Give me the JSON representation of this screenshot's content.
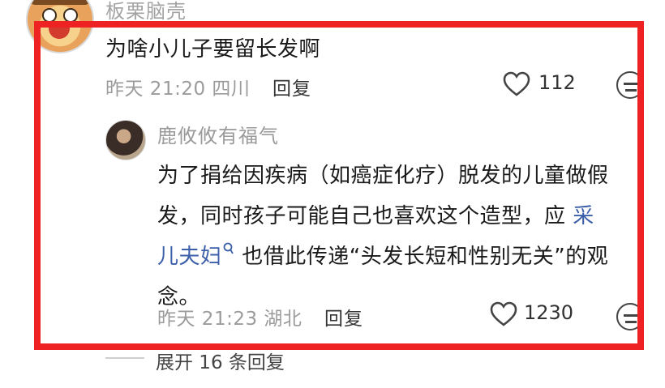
{
  "top_comment": {
    "username": "板栗脑壳",
    "text": "为啥小儿子要留长发啊",
    "meta": "昨天 21:20 四川",
    "reply_label": "回复",
    "likes": "112"
  },
  "reply_comment": {
    "username": "鹿攸攸有福气",
    "lines": [
      "为了捐给因疾病（如癌症化疗）脱发的儿童做假",
      "发，同时孩子可能自己也喜欢这个造型，应"
    ],
    "mention_a": "采",
    "mention_b": "儿夫妇",
    "line3_rest": "也借此传递“头发长短和性别无关”的观",
    "line4": "念。",
    "meta": "昨天 21:23 湖北",
    "reply_label": "回复",
    "likes": "1230"
  },
  "expand_label": "展开 16 条回复",
  "icons": {
    "like": "heart-icon",
    "dislike": "dislike-face-icon",
    "mention": "search-mention-icon"
  },
  "colors": {
    "frame": "#ee2222",
    "mention": "#3b5fa8"
  }
}
